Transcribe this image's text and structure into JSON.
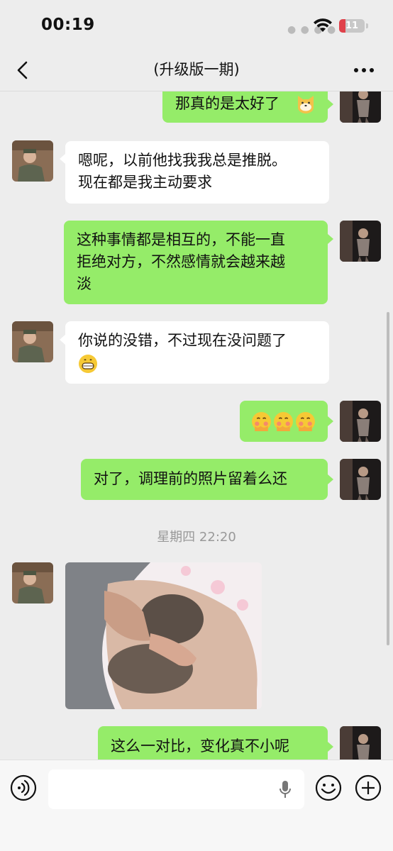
{
  "status": {
    "time": "00:19",
    "battery": "11",
    "colors": {
      "battery_low": "#e0424b"
    }
  },
  "nav": {
    "title": "(升级版一期)",
    "back_icon": "chevron-left-icon",
    "more_icon": "more-icon"
  },
  "messages": {
    "m1": {
      "side": "out",
      "text": "那真的是太好了"
    },
    "m2": {
      "side": "in",
      "lines": [
        "嗯呢，以前他找我我总是推脱。",
        "现在都是我主动要求"
      ]
    },
    "m3": {
      "side": "out",
      "lines": [
        "这种事情都是相互的，不能一直",
        "拒绝对方，不然感情就会越来越",
        "淡"
      ]
    },
    "m4": {
      "side": "in",
      "text": "你说的没错，不过现在没问题了"
    },
    "m5": {
      "side": "out",
      "text": ""
    },
    "m6": {
      "side": "out",
      "text": "对了，调理前的照片留着么还"
    },
    "timestamp": "星期四 22:20",
    "m7": {
      "side": "in",
      "type": "image"
    },
    "m8": {
      "side": "out",
      "text": "这么一对比，变化真不小呢"
    }
  },
  "bottom": {
    "voice_icon": "voice-icon",
    "mic_icon": "mic-icon",
    "emoji_icon": "emoji-icon",
    "plus_icon": "plus-icon",
    "input_value": ""
  },
  "colors": {
    "outgoing_bubble": "#95ec69",
    "incoming_bubble": "#ffffff",
    "background": "#ededed"
  }
}
